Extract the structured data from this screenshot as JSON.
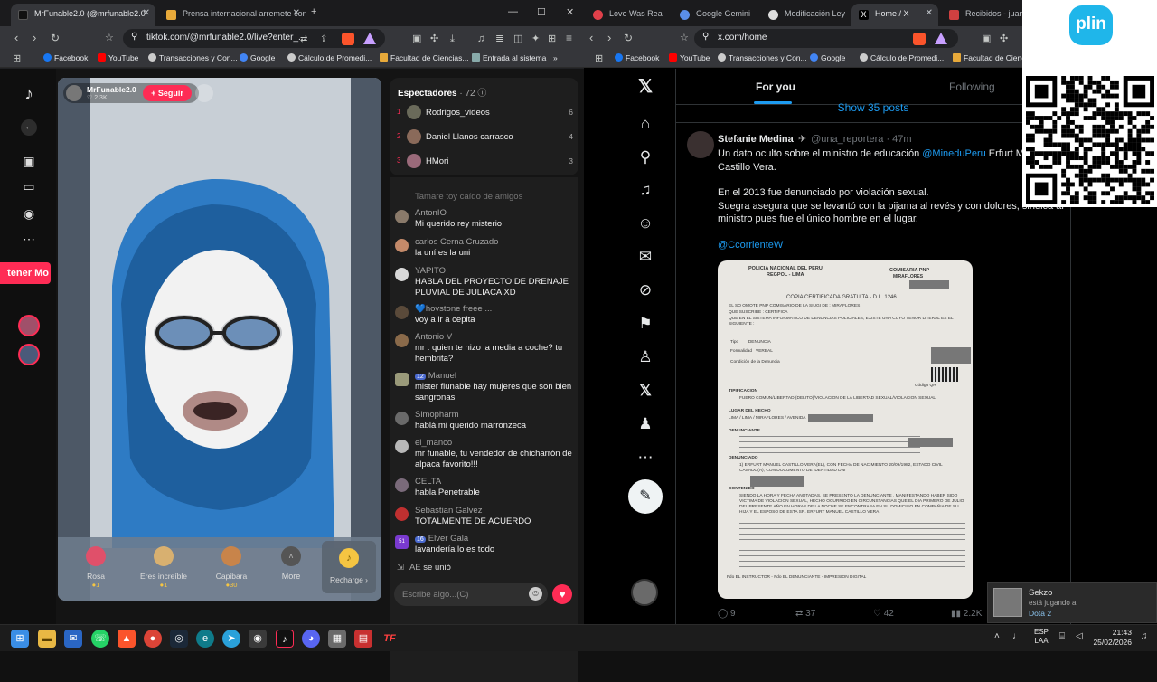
{
  "left_browser": {
    "tabs": [
      {
        "title": "MrFunable2.0 (@mrfunable2.0",
        "color": "#111111"
      },
      {
        "title": "Prensa internacional arremete contra",
        "color": "#e7a93a"
      }
    ],
    "new_tab": "+",
    "window_controls": {
      "minimize": "—",
      "maximize": "☐",
      "close": "✕"
    },
    "url": "tiktok.com/@mrfunable2.0/live?enter_...",
    "bookmarks": [
      "Facebook",
      "YouTube",
      "Transacciones y Con...",
      "Google",
      "Cálculo de Promedi...",
      "Facultad de Ciencias...",
      "Entrada al sistema"
    ],
    "bookmarks_more": "»"
  },
  "tiktok": {
    "promo_label": "tener Mo",
    "streamer": {
      "name": "MrFunable2.0",
      "likes": "♡ 2.3K",
      "follow_label": "+ Seguir"
    },
    "viewers": {
      "title": "Espectadores",
      "count": "· 72",
      "list": [
        {
          "rank": "1",
          "name": "Rodrigos_videos",
          "score": "6"
        },
        {
          "rank": "2",
          "name": "Daniel Llanos carrasco",
          "score": "4"
        },
        {
          "rank": "3",
          "name": "HMori",
          "score": "3"
        }
      ]
    },
    "chat_top_faded": "Tamare toy caído de amigos",
    "chat": [
      {
        "name": "AntonIO",
        "badge": "",
        "text": "Mi querido rey misterio",
        "color": "#8a7a6a"
      },
      {
        "name": "carlos Cerna Cruzado",
        "badge": "",
        "text": "la uní es la uni",
        "color": "#c48a6a"
      },
      {
        "name": "YAPITO",
        "badge": "",
        "text": "HABLA DEL PROYECTO DE DRENAJE PLUVIAL DE JULIACA XD",
        "color": "#d8d8d8"
      },
      {
        "name": "hovstone freee ...",
        "badge": "💙",
        "text": "voy a ir a cepita",
        "color": "#5a4a3a"
      },
      {
        "name": "Antonio V",
        "badge": "",
        "text": "mr . quien te hizo la media a coche? tu hembrita?",
        "color": "#8a6a4a"
      },
      {
        "name": "Manuel",
        "badge": "12",
        "text": "mister flunable hay mujeres que son bien sangronas",
        "color": "#9a9a7a"
      },
      {
        "name": "Simopharm",
        "badge": "",
        "text": "hablá mi querido marronzeca",
        "color": "#6a6a6a"
      },
      {
        "name": "el_manco",
        "badge": "",
        "text": "mr funable, tu vendedor de chicharrón de alpaca favorito!!!",
        "color": "#b8b8b8"
      },
      {
        "name": "CELTA",
        "badge": "",
        "text": "habla Penetrable",
        "color": "#7a6a7a"
      },
      {
        "name": "Sebastian Galvez",
        "badge": "",
        "text": "TOTALMENTE DE ACUERDO",
        "color": "#c03030"
      },
      {
        "name": "Elver Gala",
        "badge": "16",
        "text": "lavandería lo es todo",
        "color": "#7a3ad0",
        "avatar_label": "51"
      }
    ],
    "joined": {
      "name": "AE",
      "text": "se unió"
    },
    "input_placeholder": "Escribe algo...(C)",
    "gifts": [
      {
        "name": "Rosa",
        "price": "1",
        "color": "#e0506a"
      },
      {
        "name": "Eres increíble",
        "price": "1",
        "color": "#d8b070"
      },
      {
        "name": "Capibara",
        "price": "30",
        "color": "#c8844a"
      },
      {
        "name": "More",
        "price": "",
        "color": "#555555"
      }
    ],
    "recharge_label": "Recharge ›"
  },
  "right_browser": {
    "tabs": [
      {
        "title": "Love Was Real",
        "color": "#e0404a"
      },
      {
        "title": "Google Gemini",
        "color": "#5a8ee8"
      },
      {
        "title": "Modificación Ley",
        "color": "#dddddd"
      },
      {
        "title": "Home / X",
        "color": "#ffffff"
      },
      {
        "title": "Recibidos - juana",
        "color": "#d04040"
      }
    ],
    "url": "x.com/home",
    "bookmarks": [
      "Facebook",
      "YouTube",
      "Transacciones y Con...",
      "Google",
      "Cálculo de Promedi...",
      "Facultad de Ciencias..."
    ]
  },
  "x": {
    "tabs": {
      "for_you": "For you",
      "following": "Following"
    },
    "show_posts": "Show 35 posts",
    "post": {
      "author": "Stefanie Medina",
      "handle": "@una_reportera",
      "time": "· 47m",
      "text1a": "Un dato oculto sobre el ministro de educación ",
      "mention": "@MineduPeru",
      "text1b": "  Erfurt M",
      "text1c": "Castillo Vera.",
      "text2": "En el 2013 fue denunciado por violación sexual.",
      "text3": "Suegra asegura que se levantó con la pijama al revés y con dolores, sindica al ministro pues fue el único hombre en el lugar.",
      "mention2": "@CcorrienteW",
      "stats": {
        "replies": "9",
        "reposts": "37",
        "likes": "42",
        "views": "2.2K"
      }
    },
    "document": {
      "l1": "POLICIA NACIONAL DEL PERU",
      "l2": "REGPOL - LIMA",
      "l3": "COMISARIA PNP",
      "l4": "MIRAFLORES",
      "l5": "COPIA CERTIFICADA GRATUITA - D.L. 1246",
      "l6": "EL SO OMOTE PNP COMISARIO DE LA SIUGI DE : MIRAFLORES",
      "l7": "QUE SUSCRIBE : CERTIFICA",
      "l8": "QUE EN EL SISTEMA INFORMATICO DE DENUNCIAS POLICIALES, EXISTE UNA CUYO TENOR LITERAL ES EL SIGUIENTE :",
      "l9": "Tipo        DENUNCIA",
      "l10": "Formalidad   VERBAL",
      "l11": "Condición de la Denuncia",
      "l12": "TIPIFICACION",
      "l13": "FUERO COMUN/LIBERTAD (DELITO)/VIOLACION DE LA LIBERTAD SEXUAL/VIOLACION SEXUAL",
      "l14": "LUGAR DEL HECHO",
      "l15": "LIMA / LIMA / MIRAFLORES / AVENIDA",
      "l16": "DENUNCIANTE",
      "l17": "DENUNCIADO",
      "l18": "1) ERFURT MANUEL CASTILLO VERA(EL), CON FECHA DE NACIMIENTO 20/09/1982, ESTADO CIVIL CASADO(A), CON DOCUMENTO DE IDENTIDAD DNI",
      "l19": "CONTENIDO",
      "l20": "SIENDO LA HORA Y FECHA ANOTADAS, SE PRESENTO LA DENUNCIANTE , MANIFESTANDO HABER SIDO VICTIMA DE VIOLACION SEXUAL, HECHO OCURRIDO EN CIRCUNSTANCIAS QUE EL DIA PRIMERO DE JULIO DEL PRESENTE AÑO EN HORAS DE LA NOCHE SE ENCONTRABA EN SU DOMICILIO EN COMPAÑIA DE SU HIJA Y EL ESPOSO DE ESTA SR. ERFURT MANUEL CASTILLO VERA",
      "l21": "Código QR",
      "l22": "Fdo EL INSTRUCTOR - Fdo EL DENUNCIANTE - IMPRESION DIGITAL"
    }
  },
  "overlay": {
    "plin": "plin",
    "notification": {
      "name": "Sekzo",
      "status": "está jugando a",
      "game": "Dota 2"
    }
  },
  "taskbar": {
    "lang": "ESP",
    "lang2": "LAA",
    "time": "21:43",
    "date": "25/02/2026"
  }
}
